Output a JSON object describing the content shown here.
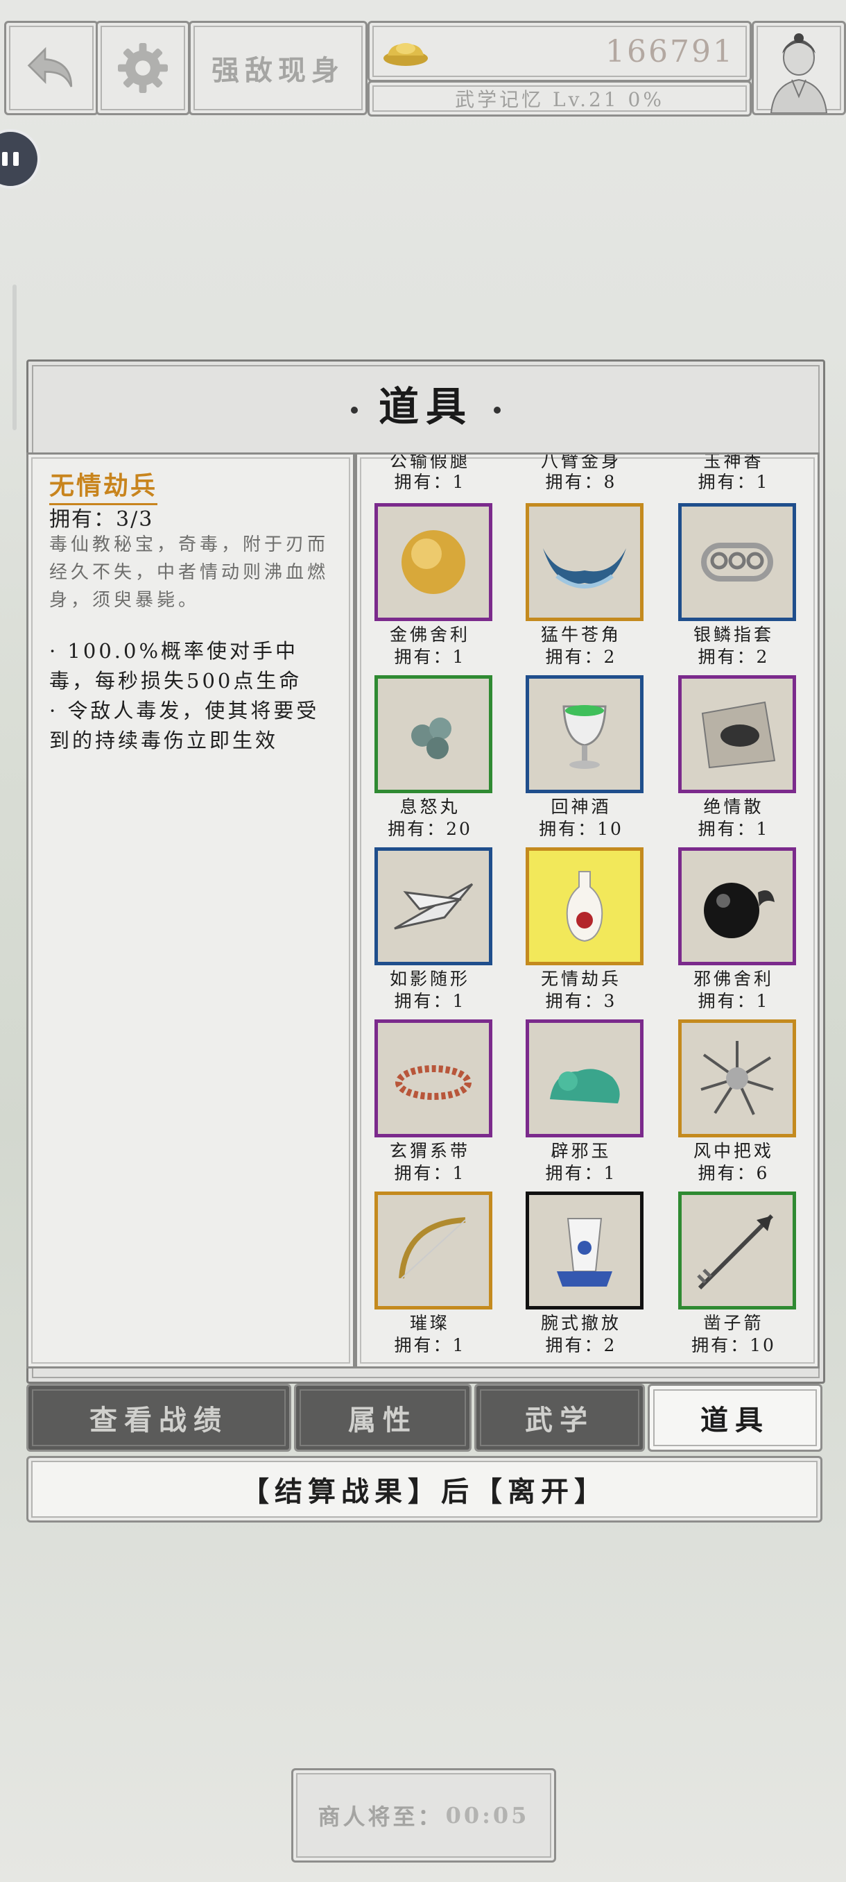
{
  "header": {
    "title_button": "强敌现身",
    "gold": "166791",
    "level_text": "武学记忆 Lv.21 0%"
  },
  "panel": {
    "title": "道具"
  },
  "detail": {
    "name": "无情劫兵",
    "owned": "拥有：3/3",
    "description": "毒仙教秘宝，奇毒，附于刃而经久不失，中者情动则沸血燃身，须臾暴毙。",
    "effect": "· 100.0%概率使对手中毒，每秒损失500点生命\n· 令敌人毒发，使其将要受到的持续毒伤立即生效"
  },
  "grid": {
    "top_partial": [
      {
        "name": "公输假腿",
        "owned": "拥有：1"
      },
      {
        "name": "八臂金身",
        "owned": "拥有：8"
      },
      {
        "name": "玉神香",
        "owned": "拥有：1"
      }
    ],
    "items": [
      {
        "name": "金佛舍利",
        "owned": "拥有：1",
        "icon": "golden-relic-icon",
        "border": "#7b2a8c",
        "bg": "#d8d3c7"
      },
      {
        "name": "猛牛苍角",
        "owned": "拥有：2",
        "icon": "ox-horn-icon",
        "border": "#c48a1e",
        "bg": "#d8d3c7"
      },
      {
        "name": "银鳞指套",
        "owned": "拥有：2",
        "icon": "brass-knuckles-icon",
        "border": "#1f4e8c",
        "bg": "#d8d3c7"
      },
      {
        "name": "息怒丸",
        "owned": "拥有：20",
        "icon": "pills-icon",
        "border": "#2f8a32",
        "bg": "#d8d3c7"
      },
      {
        "name": "回神酒",
        "owned": "拥有：10",
        "icon": "wine-goblet-icon",
        "border": "#1f4e8c",
        "bg": "#d8d3c7"
      },
      {
        "name": "绝情散",
        "owned": "拥有：1",
        "icon": "powder-paper-icon",
        "border": "#7b2a8c",
        "bg": "#d8d3c7"
      },
      {
        "name": "如影随形",
        "owned": "拥有：1",
        "icon": "throwing-darts-icon",
        "border": "#1f4e8c",
        "bg": "#d8d3c7"
      },
      {
        "name": "无情劫兵",
        "owned": "拥有：3",
        "icon": "poison-vase-icon",
        "border": "#c48a1e",
        "bg": "#f2e85a"
      },
      {
        "name": "邪佛舍利",
        "owned": "拥有：1",
        "icon": "black-relic-icon",
        "border": "#7b2a8c",
        "bg": "#d8d3c7"
      },
      {
        "name": "玄猬系带",
        "owned": "拥有：1",
        "icon": "bead-bracelet-icon",
        "border": "#7b2a8c",
        "bg": "#d8d3c7"
      },
      {
        "name": "辟邪玉",
        "owned": "拥有：1",
        "icon": "jade-beast-icon",
        "border": "#7b2a8c",
        "bg": "#d8d3c7"
      },
      {
        "name": "风中把戏",
        "owned": "拥有：6",
        "icon": "blade-fan-icon",
        "border": "#c48a1e",
        "bg": "#d8d3c7"
      },
      {
        "name": "璀璨",
        "owned": "拥有：1",
        "icon": "golden-bow-icon",
        "border": "#c48a1e",
        "bg": "#d8d3c7"
      },
      {
        "name": "腕式撤放",
        "owned": "拥有：2",
        "icon": "porcelain-bracer-icon",
        "border": "#111111",
        "bg": "#d8d3c7"
      },
      {
        "name": "凿子箭",
        "owned": "拥有：10",
        "icon": "arrow-icon",
        "border": "#2f8a32",
        "bg": "#d8d3c7"
      }
    ]
  },
  "tabs": {
    "record": "查看战绩",
    "attributes": "属性",
    "martial": "武学",
    "items": "道具"
  },
  "leave_button": "【结算战果】后【离开】",
  "merchant": {
    "label": "商人将至：",
    "timer": "00:05"
  }
}
